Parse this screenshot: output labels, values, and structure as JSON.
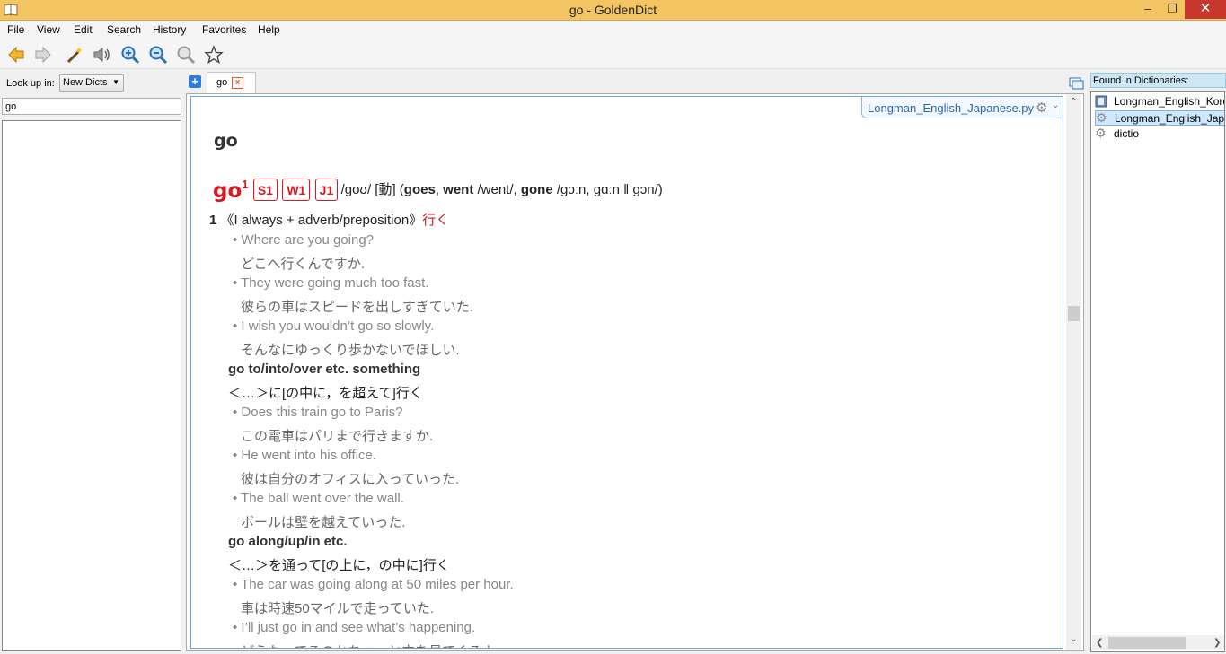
{
  "window": {
    "title": "go - GoldenDict"
  },
  "menu": {
    "file": "File",
    "view": "View",
    "edit": "Edit",
    "search": "Search",
    "history": "History",
    "favorites": "Favorites",
    "help": "Help"
  },
  "toolbar": {
    "icons": [
      "back-arrow-icon",
      "forward-arrow-icon",
      "magic-wand-icon",
      "speaker-icon",
      "zoom-in-icon",
      "zoom-out-icon",
      "zoom-reset-icon",
      "star-icon"
    ]
  },
  "lookup": {
    "label": "Look up in:",
    "group": "New Dicts",
    "query": "go"
  },
  "tabs": [
    {
      "label": "go"
    }
  ],
  "article": {
    "dictionary": "Longman_English_Japanese.py",
    "headword": "go",
    "entry": {
      "word": "go",
      "sup": "1",
      "badges": [
        "S1",
        "W1",
        "J1"
      ],
      "pron_a": "/goʊ/ [動] (",
      "form1": "goes",
      "sep1": ", ",
      "form2": "went",
      "pron_b": " /went/, ",
      "form3": "gone",
      "pron_c": " /gɔːn, gɑːn ǁ gɔn/)"
    },
    "sense1": {
      "num": "1",
      "text": " 《I always + adverb/preposition》",
      "ja": "行く"
    },
    "examples1": [
      {
        "en": "• Where are you going?",
        "ja": "どこへ行くんですか."
      },
      {
        "en": "• They were going much too fast.",
        "ja": "彼らの車はスピードを出しすぎていた."
      },
      {
        "en": "• I wish you wouldn’t go so slowly.",
        "ja": "そんなにゆっくり歩かないでほしい."
      }
    ],
    "phrase1": {
      "en": "go to/into/over etc. something",
      "ja": "＜…＞に[の中に，を超えて]行く"
    },
    "examples2": [
      {
        "en": "• Does this train go to Paris?",
        "ja": "この電車はパリまで行きますか."
      },
      {
        "en": "• He went into his office.",
        "ja": "彼は自分のオフィスに入っていった."
      },
      {
        "en": "• The ball went over the wall.",
        "ja": "ボールは壁を越えていった."
      }
    ],
    "phrase2": {
      "en": "go along/up/in etc.",
      "ja": "＜…＞を通って[の上に，の中に]行く"
    },
    "examples3": [
      {
        "en": "• The car was going along at 50 miles per hour.",
        "ja": "車は時速50マイルで走っていた."
      },
      {
        "en": "• I’ll just go in and see what’s happening.",
        "ja": "どうなってるのかちょっと中を見てくるよ."
      }
    ]
  },
  "found": {
    "header": "Found in Dictionaries:",
    "items": [
      {
        "label": "Longman_English_Korean.py",
        "icon": "book-icon"
      },
      {
        "label": "Longman_English_Japanese.py",
        "icon": "gear-icon"
      },
      {
        "label": "dictio",
        "icon": "gear-icon"
      }
    ]
  }
}
